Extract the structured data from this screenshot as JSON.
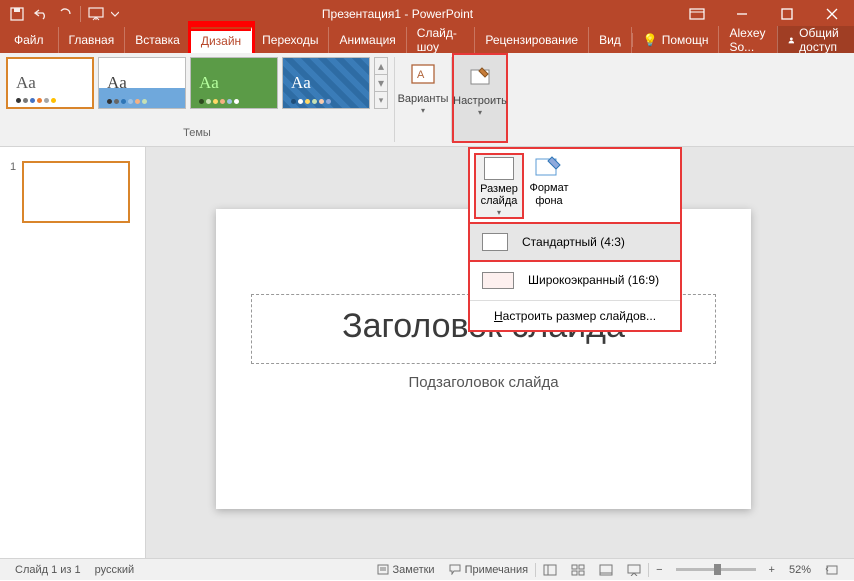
{
  "title": "Презентация1 - PowerPoint",
  "qat": {
    "save": "save",
    "undo": "undo",
    "redo": "redo",
    "start": "start"
  },
  "tabs": {
    "file": "Файл",
    "home": "Главная",
    "insert": "Вставка",
    "design": "Дизайн",
    "transitions": "Переходы",
    "animations": "Анимация",
    "slideshow": "Слайд-шоу",
    "review": "Рецензирование",
    "view": "Вид",
    "help": "Помощн",
    "user": "Alexey So...",
    "share": "Общий доступ"
  },
  "ribbon": {
    "themes_label": "Темы",
    "variants": "Варианты",
    "customize": "Настроить"
  },
  "dropdown": {
    "slide_size": "Размер слайда",
    "format_bg": "Формат фона",
    "standard": "Стандартный (4:3)",
    "widescreen": "Широкоэкранный (16:9)",
    "custom": "Настроить размер слайдов...",
    "custom_u": "Н"
  },
  "slide": {
    "title": "Заголовок слайда",
    "subtitle": "Подзаголовок слайда",
    "num": "1"
  },
  "status": {
    "slide_info": "Слайд 1 из 1",
    "lang": "русский",
    "notes": "Заметки",
    "comments": "Примечания",
    "zoom": "52%"
  }
}
